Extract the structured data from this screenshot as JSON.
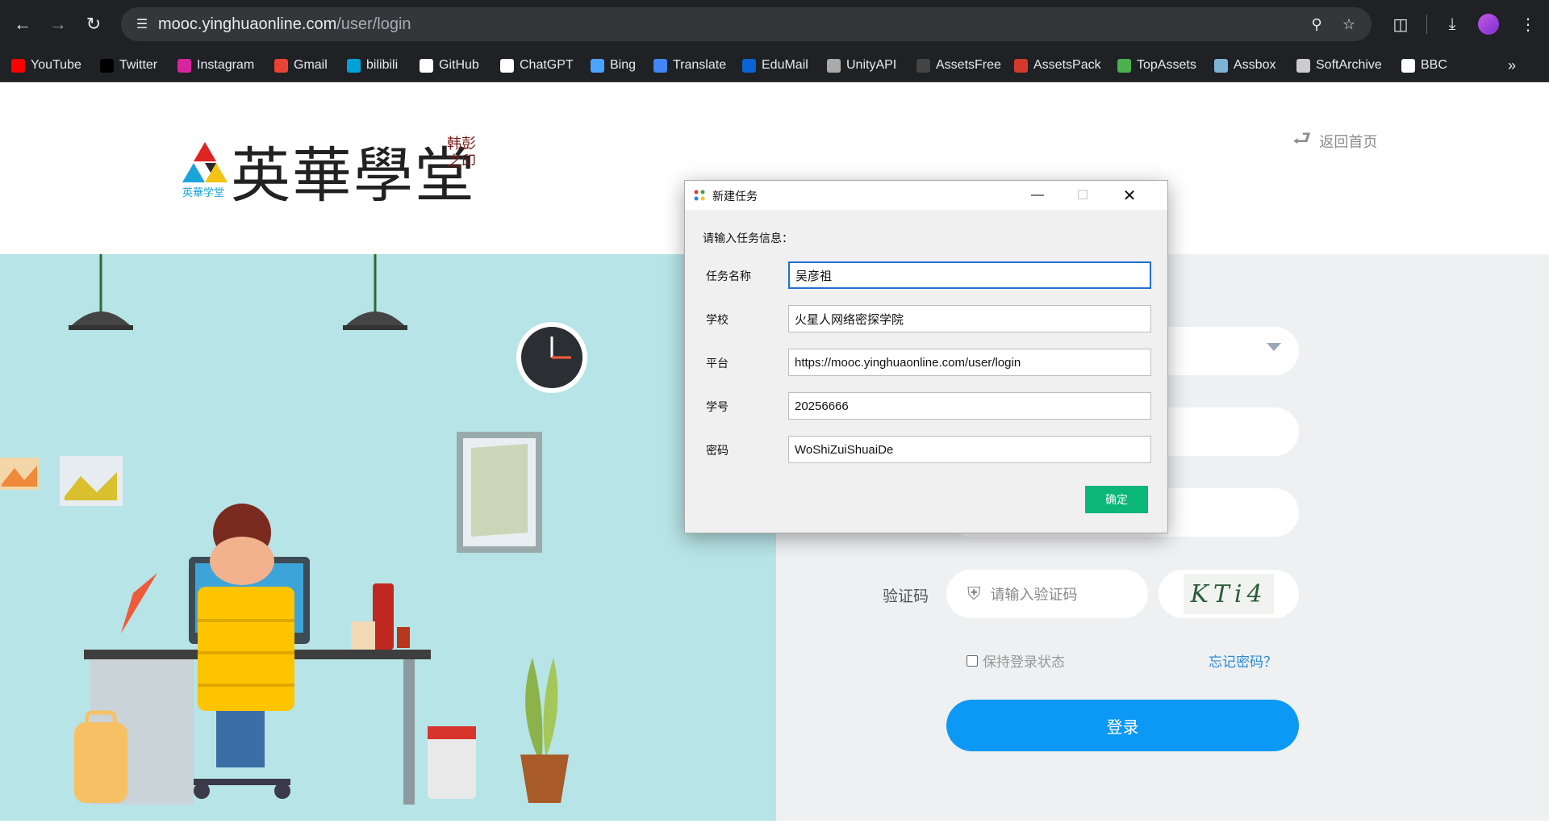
{
  "browser": {
    "url_host": "mooc.yinghuaonline.com",
    "url_path": "/user/login",
    "bookmarks": [
      {
        "label": "YouTube",
        "icon": "youtube-icon",
        "color": "#ff0000"
      },
      {
        "label": "Twitter",
        "icon": "x-icon",
        "color": "#000000"
      },
      {
        "label": "Instagram",
        "icon": "instagram-icon",
        "color": "#d6249f"
      },
      {
        "label": "Gmail",
        "icon": "gmail-icon",
        "color": "#ea4335"
      },
      {
        "label": "bilibili",
        "icon": "bilibili-icon",
        "color": "#00a1d6"
      },
      {
        "label": "GitHub",
        "icon": "github-icon",
        "color": "#ffffff"
      },
      {
        "label": "ChatGPT",
        "icon": "chatgpt-icon",
        "color": "#ffffff"
      },
      {
        "label": "Bing",
        "icon": "search-icon",
        "color": "#4aa3ff"
      },
      {
        "label": "Translate",
        "icon": "translate-icon",
        "color": "#4285f4"
      },
      {
        "label": "EduMail",
        "icon": "outlook-icon",
        "color": "#0a64d6"
      },
      {
        "label": "UnityAPI",
        "icon": "unity-icon",
        "color": "#aaaaaa"
      },
      {
        "label": "AssetsFree",
        "icon": "unreal-icon",
        "color": "#444444"
      },
      {
        "label": "AssetsPack",
        "icon": "assetspack-icon",
        "color": "#d33a2c"
      },
      {
        "label": "TopAssets",
        "icon": "topassets-icon",
        "color": "#4caf50"
      },
      {
        "label": "Assbox",
        "icon": "assbox-icon",
        "color": "#7fb3d5"
      },
      {
        "label": "SoftArchive",
        "icon": "softarchive-icon",
        "color": "#cccccc"
      },
      {
        "label": "BBC",
        "icon": "bbc-icon",
        "color": "#ffffff"
      }
    ]
  },
  "page": {
    "logo_main": "英華學堂",
    "logo_sub": "英華学堂",
    "logo_seal": "韩彭之印",
    "back_home": "返回首页",
    "captcha_label": "验证码",
    "captcha_placeholder": "请输入验证码",
    "captcha_code": "KTi4",
    "remember_label": "保持登录状态",
    "forgot_label": "忘记密码？",
    "login_label": "登录"
  },
  "dialog": {
    "title": "新建任务",
    "prompt": "请输入任务信息：",
    "fields": [
      {
        "label": "任务名称",
        "value": "吴彦祖"
      },
      {
        "label": "学校",
        "value": "火星人网络密探学院"
      },
      {
        "label": "平台",
        "value": "https://mooc.yinghuaonline.com/user/login"
      },
      {
        "label": "学号",
        "value": "20256666"
      },
      {
        "label": "密码",
        "value": "WoShiZuiShuaiDe"
      }
    ],
    "ok_label": "确定"
  },
  "colors": {
    "accent": "#0c99f5",
    "ok_button": "#0bb679",
    "hero_bg": "#b7e4e6"
  }
}
